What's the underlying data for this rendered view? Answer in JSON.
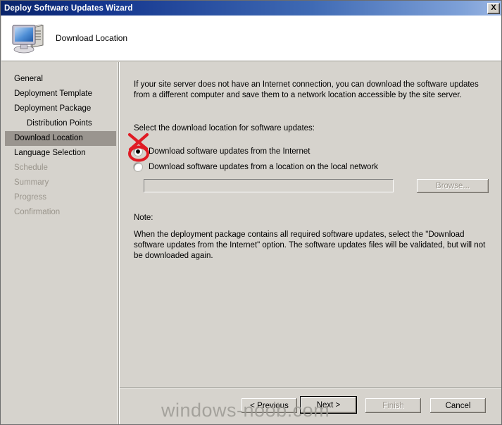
{
  "window": {
    "title": "Deploy Software Updates Wizard",
    "close_label": "X",
    "header_title": "Download Location",
    "header_icon": "computer-icon"
  },
  "sidebar": {
    "items": [
      {
        "label": "General",
        "state": "normal",
        "indent": false
      },
      {
        "label": "Deployment Template",
        "state": "normal",
        "indent": false
      },
      {
        "label": "Deployment Package",
        "state": "normal",
        "indent": false
      },
      {
        "label": "Distribution Points",
        "state": "normal",
        "indent": true
      },
      {
        "label": "Download Location",
        "state": "selected",
        "indent": false
      },
      {
        "label": "Language Selection",
        "state": "normal",
        "indent": false
      },
      {
        "label": "Schedule",
        "state": "disabled",
        "indent": false
      },
      {
        "label": "Summary",
        "state": "disabled",
        "indent": false
      },
      {
        "label": "Progress",
        "state": "disabled",
        "indent": false
      },
      {
        "label": "Confirmation",
        "state": "disabled",
        "indent": false
      }
    ]
  },
  "content": {
    "intro": "If your site server does not have an Internet connection, you can download the software updates from a different computer and save them to a network location accessible by the site server.",
    "select_label": "Select the download location for software updates:",
    "options": [
      {
        "label": "Download software updates from the Internet",
        "selected": true
      },
      {
        "label": "Download software updates from a location on the local network",
        "selected": false
      }
    ],
    "path_value": "",
    "browse_label": "Browse...",
    "note_label": "Note:",
    "note_text": "When the deployment package contains all required software updates, select the \"Download software updates from the Internet\" option. The software updates files will be validated, but will not be downloaded again."
  },
  "footer": {
    "previous_label": "< Previous",
    "next_label": "Next >",
    "finish_label": "Finish",
    "cancel_label": "Cancel"
  },
  "watermark": {
    "text": "windows-noob.com"
  },
  "annotation": {
    "type": "red-x-and-circle-marker",
    "color": "#e01b24",
    "target": "radio-download-from-internet"
  },
  "colors": {
    "titlebar_start": "#0a246a",
    "titlebar_end": "#9cb6e2",
    "dialog_face": "#d6d3cd",
    "selected_item": "#9a958f",
    "disabled_text": "#9a958c",
    "annotation_red": "#e01b24"
  }
}
